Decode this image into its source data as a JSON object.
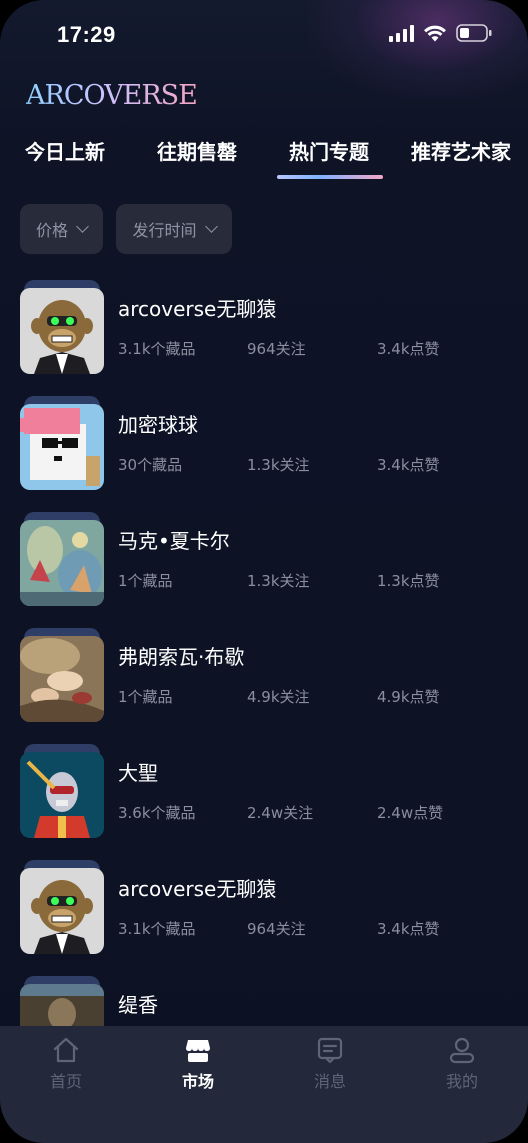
{
  "status": {
    "time": "17:29"
  },
  "brand": {
    "logo_text": "ARCOVERSE"
  },
  "tabs": [
    {
      "label": "今日上新"
    },
    {
      "label": "往期售罄"
    },
    {
      "label": "热门专题"
    },
    {
      "label": "推荐艺术家"
    }
  ],
  "active_tab": "热门专题",
  "filters": [
    {
      "label": "价格"
    },
    {
      "label": "发行时间"
    }
  ],
  "topics": [
    {
      "title": "arcoverse无聊猿",
      "collections": "3.1k个藏品",
      "followers": "964关注",
      "likes": "3.4k点赞"
    },
    {
      "title": "加密球球",
      "collections": "30个藏品",
      "followers": "1.3k关注",
      "likes": "3.4k点赞"
    },
    {
      "title": "马克•夏卡尔",
      "collections": "1个藏品",
      "followers": "1.3k关注",
      "likes": "1.3k点赞"
    },
    {
      "title": "弗朗索瓦·布歇",
      "collections": "1个藏品",
      "followers": "4.9k关注",
      "likes": "4.9k点赞"
    },
    {
      "title": "大聖",
      "collections": "3.6k个藏品",
      "followers": "2.4w关注",
      "likes": "2.4w点赞"
    },
    {
      "title": "arcoverse无聊猿",
      "collections": "3.1k个藏品",
      "followers": "964关注",
      "likes": "3.4k点赞"
    },
    {
      "title": "缇香",
      "collections": "",
      "followers": "",
      "likes": ""
    }
  ],
  "nav": [
    {
      "label": "首页",
      "icon": "home-icon"
    },
    {
      "label": "市场",
      "icon": "market-icon"
    },
    {
      "label": "消息",
      "icon": "message-icon"
    },
    {
      "label": "我的",
      "icon": "profile-icon"
    }
  ],
  "active_nav": "市场",
  "colors": {
    "background": "#0d1124",
    "filter_bg": "#272b3a",
    "nav_bg": "#23283a",
    "muted_text": "#8a8e9e"
  }
}
